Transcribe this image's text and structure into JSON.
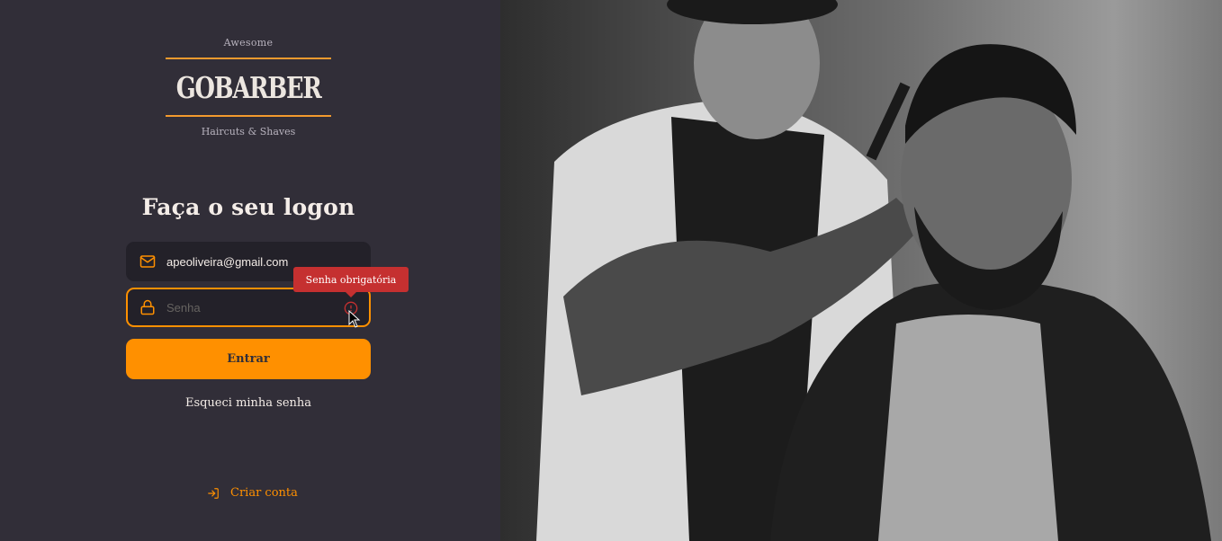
{
  "logo": {
    "top_text": "Awesome",
    "brand": "GOBARBER",
    "bottom_text": "Haircuts & Shaves"
  },
  "form": {
    "title": "Faça o seu logon",
    "email": {
      "value": "apeoliveira@gmail.com",
      "icon": "mail-icon"
    },
    "password": {
      "placeholder": "Senha",
      "value": "",
      "icon": "lock-icon"
    },
    "error_tooltip": "Senha obrigatória",
    "submit_label": "Entrar",
    "forgot_label": "Esqueci minha senha"
  },
  "create_account": {
    "label": "Criar conta",
    "icon": "log-in-icon"
  },
  "colors": {
    "background": "#312e38",
    "accent": "#ff9000",
    "input_bg": "#232129",
    "error": "#c53030",
    "text": "#f4ede8"
  }
}
